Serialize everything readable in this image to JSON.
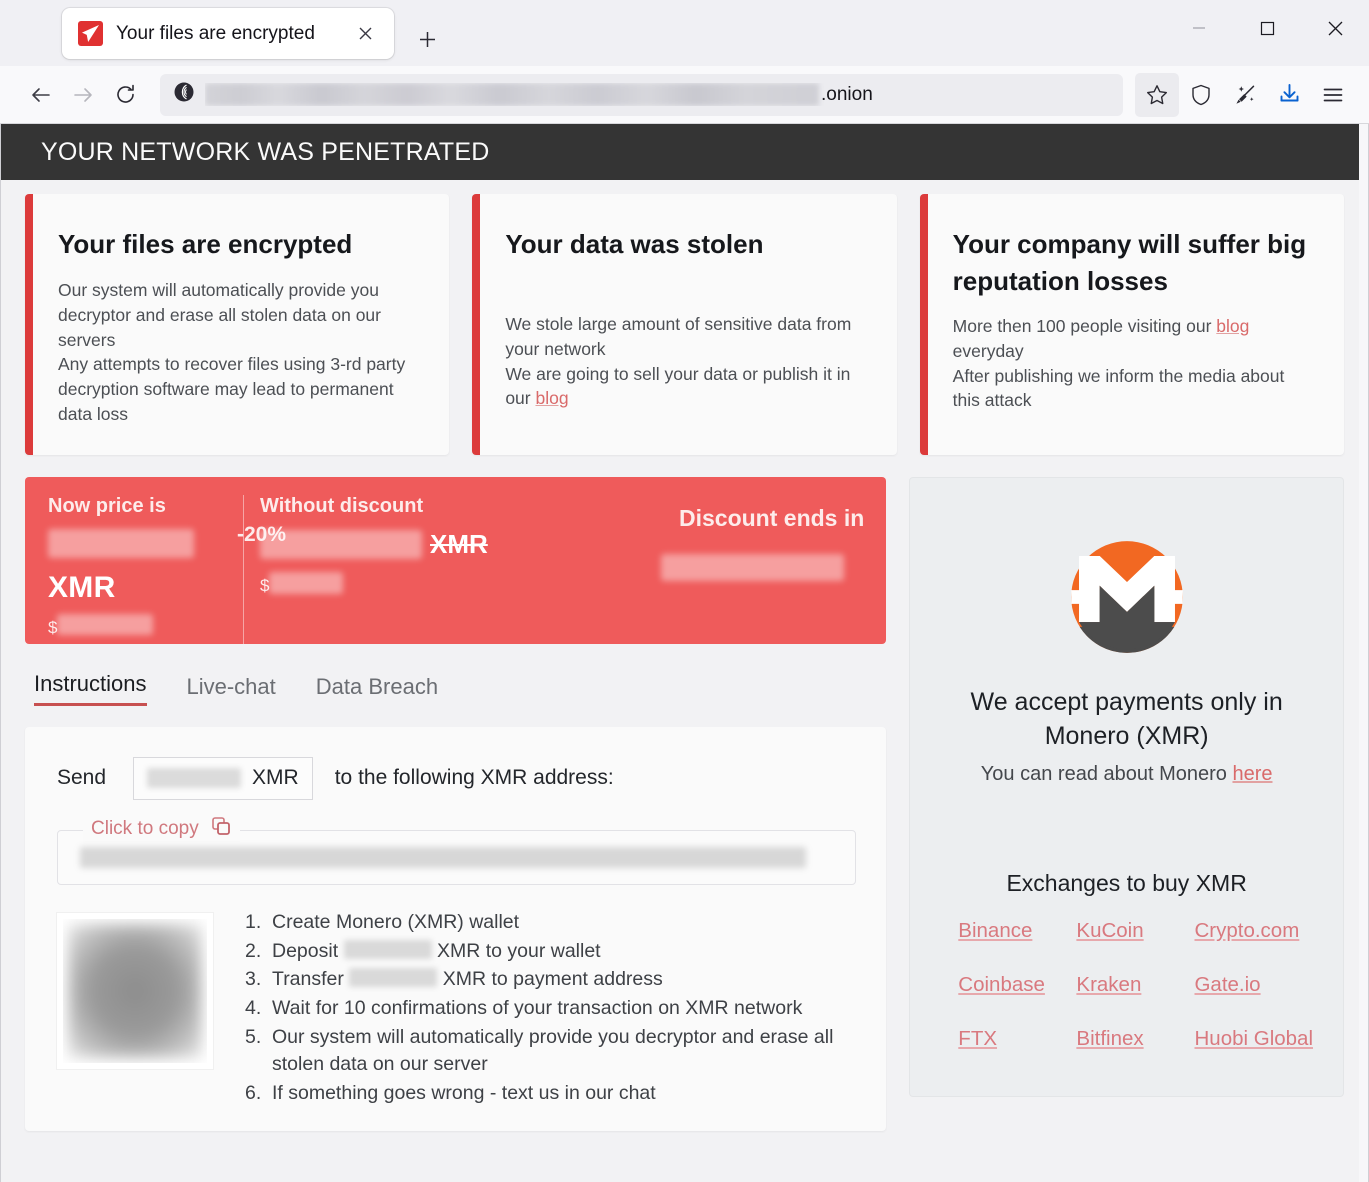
{
  "browser": {
    "tab": {
      "title": "Your files are encrypted",
      "favicon_icon": "red-dart-favicon",
      "close_icon": "close-icon"
    },
    "new_tab_icon": "plus-icon",
    "window_controls": {
      "minimize_icon": "minimize-icon",
      "maximize_icon": "maximize-icon",
      "close_icon": "close-icon"
    },
    "nav": {
      "back_icon": "arrow-left-icon",
      "forward_icon": "arrow-right-icon",
      "reload_icon": "reload-icon"
    },
    "url": {
      "site_icon": "onion-site-icon",
      "value_redacted": true,
      "visible_suffix": ".onion"
    },
    "toolbar": {
      "bookmark_icon": "star-icon",
      "shield_icon": "shield-icon",
      "new_identity_icon": "broom-sparkle-icon",
      "downloads_icon": "download-arrow-icon",
      "menu_icon": "hamburger-menu-icon"
    }
  },
  "page": {
    "banner": "YOUR NETWORK WAS PENETRATED",
    "cards": [
      {
        "title": "Your files are encrypted",
        "lines": [
          "Our system will automatically provide you decryptor and erase all stolen data on our servers",
          "Any attempts to recover files using 3-rd party decryption software may lead to permanent data loss"
        ]
      },
      {
        "title": "Your data was stolen",
        "lines": [
          "We stole large amount of sensitive data from your network",
          "We are going to sell your data or publish it in our "
        ],
        "link_label": "blog"
      },
      {
        "title": "Your company will suffer big reputation losses",
        "lines_pre_link": "More then 100 people visiting our ",
        "link_label": "blog",
        "lines_post_link": " everyday",
        "line2": "After publishing we inform the media about this attack"
      }
    ],
    "price": {
      "now_label": "Now price is",
      "now_amount_redacted": true,
      "now_currency": "XMR",
      "now_usd_symbol": "$",
      "now_usd_redacted": true,
      "discount_badge": "-20%",
      "without_label": "Without discount",
      "without_amount_redacted": true,
      "without_currency": "XMR",
      "without_usd_symbol": "$",
      "without_usd_redacted": true,
      "ends_label": "Discount ends in",
      "ends_timer_redacted": true
    },
    "tabs": [
      {
        "label": "Instructions",
        "active": true
      },
      {
        "label": "Live-chat",
        "active": false
      },
      {
        "label": "Data Breach",
        "active": false
      }
    ],
    "instructions": {
      "send_word": "Send",
      "send_amount_redacted": true,
      "send_currency": "XMR",
      "send_suffix": "to the following XMR address:",
      "copy_label": "Click to copy",
      "copy_icon": "copy-icon",
      "address_redacted": true,
      "qr_label": "qr-code",
      "steps": [
        "Create Monero (XMR) wallet",
        "Deposit \u0000 XMR to your wallet",
        "Transfer \u0000 XMR to payment address",
        "Wait for 10 confirmations of your transaction on XMR network",
        "Our system will automatically provide you decryptor and erase all stolen data on our server",
        "If something goes wrong - text us in our chat"
      ],
      "step2_pre": "Deposit",
      "step2_post": "XMR to your wallet",
      "step3_pre": "Transfer",
      "step3_post": "XMR to payment address",
      "step4": "Wait for 10 confirmations of your transaction on XMR network",
      "step5": "Our system will automatically provide you decryptor and erase all stolen data on our server",
      "step6": "If something goes wrong - text us in our chat",
      "step1": "Create Monero (XMR) wallet"
    },
    "sidebar": {
      "logo": "monero-logo",
      "accept_text": "We accept payments only in Monero (XMR)",
      "read_pre": "You can read about Monero ",
      "read_link": "here",
      "exchanges_title": "Exchanges to buy XMR",
      "exchanges": [
        "Binance",
        "KuCoin",
        "Crypto.com",
        "Coinbase",
        "Kraken",
        "Gate.io",
        "FTX",
        "Bitfinex",
        "Huobi Global"
      ]
    }
  },
  "colors": {
    "banner_bg": "#343434",
    "accent_red": "#dc3b3b",
    "price_bg": "#ef5b5b",
    "link_red": "#d9797f",
    "monero_orange": "#f26822",
    "monero_gray": "#4c4c4c"
  }
}
